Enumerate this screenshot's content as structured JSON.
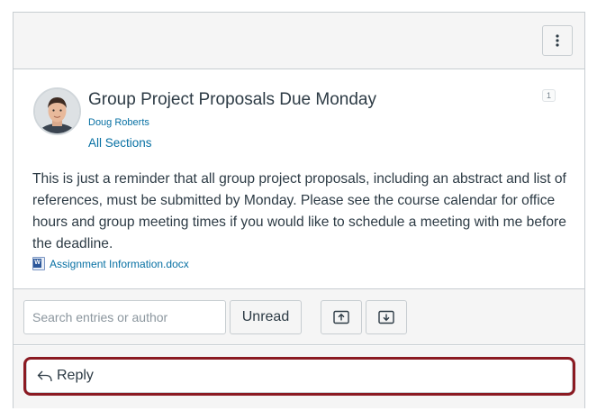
{
  "header": {
    "menu_icon": "kebab-vertical-icon"
  },
  "post": {
    "title": "Group Project Proposals Due Monday",
    "author": "Doug Roberts",
    "sections": "All Sections",
    "reply_count": "1",
    "body": "This is just a reminder that all group project proposals, including an abstract and list of references, must be submitted by Monday. Please see the course calendar for office hours and group meeting times if you would like to schedule a meeting with me before the deadline.",
    "attachment": {
      "icon": "word-document-icon",
      "name": "Assignment Information.docx"
    }
  },
  "toolbar": {
    "search_placeholder": "Search entries or author",
    "unread_label": "Unread",
    "collapse_icon": "collapse-threads-icon",
    "expand_icon": "expand-threads-icon"
  },
  "reply": {
    "icon": "reply-arrow-icon",
    "label": "Reply"
  },
  "colors": {
    "link": "#0770a3",
    "text": "#2d3b45",
    "border": "#c7cdd1",
    "highlight": "#8b1a22"
  }
}
